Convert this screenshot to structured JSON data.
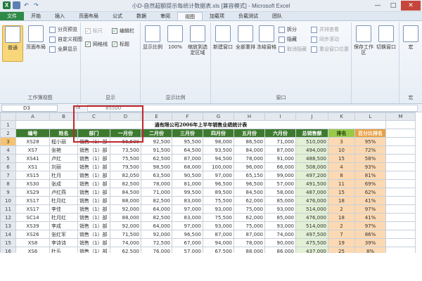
{
  "window": {
    "title": "小D-自然超额提示每统计数据表.xls [兼容模式] - Microsoft Excel",
    "app_icon_letter": "X",
    "controls": [
      "—",
      "□",
      "✕"
    ]
  },
  "tabs": [
    "文件",
    "开始",
    "插入",
    "页面布局",
    "公式",
    "数据",
    "审阅",
    "视图",
    "加载项",
    "负载测试",
    "团队"
  ],
  "active_tab": "视图",
  "ribbon": {
    "group1": {
      "label": "工作簿视图",
      "big_button": "普通",
      "big_button2": "页面布局",
      "items": [
        "分页预览",
        "自定义视图",
        "全屏显示"
      ]
    },
    "group2": {
      "label": "显示",
      "items": [
        "标尺",
        "编辑栏",
        "网格线",
        "标题"
      ]
    },
    "group3": {
      "label": "显示比例",
      "big1": "显示比例",
      "big2": "100%",
      "big3": "缩放到选定区域"
    },
    "group4": {
      "label": "窗口",
      "big1": "新建窗口",
      "big2": "全部重排",
      "big3": "冻结窗格",
      "items": [
        "拆分",
        "隐藏",
        "取消隐藏",
        "并排查看",
        "同步滚动",
        "重设窗口位置"
      ],
      "big4": "保存工作区",
      "big5": "切换窗口"
    },
    "group5": {
      "label": "宏",
      "big1": "宏"
    }
  },
  "formula_bar": {
    "cell_ref": "D3",
    "fx_label": "fx",
    "value": "85500"
  },
  "columns": [
    "A",
    "B",
    "C",
    "D",
    "E",
    "F",
    "G",
    "H",
    "I",
    "J",
    "K",
    "L",
    "M"
  ],
  "sheet_title": "通有限公司2006年上半年销售业绩统计表",
  "headers": [
    "编号",
    "姓名",
    "部门",
    "一月份",
    "二月份",
    "三月份",
    "四月份",
    "五月份",
    "六月份",
    "总销售额",
    "排名",
    "百分比排名"
  ],
  "rows": [
    {
      "n": "3",
      "cells": [
        "XS28",
        "程小丽",
        "销售（1）部",
        "66,500",
        "92,500",
        "95,500",
        "98,000",
        "86,500",
        "71,000",
        "510,000",
        "3",
        "95%"
      ]
    },
    {
      "n": "4",
      "cells": [
        "XS7",
        "张艳",
        "销售（1）部",
        "73,500",
        "91,500",
        "64,500",
        "93,500",
        "84,000",
        "87,000",
        "494,000",
        "10",
        "72%"
      ]
    },
    {
      "n": "5",
      "cells": [
        "XS41",
        "卢红",
        "销售（1）部",
        "75,500",
        "62,500",
        "87,000",
        "94,500",
        "78,000",
        "91,000",
        "488,500",
        "15",
        "58%"
      ]
    },
    {
      "n": "6",
      "cells": [
        "XS1",
        "刘丽",
        "销售（1）部",
        "79,500",
        "98,500",
        "68,000",
        "100,000",
        "96,000",
        "66,000",
        "508,000",
        "4",
        "93%"
      ]
    },
    {
      "n": "7",
      "cells": [
        "XS15",
        "杜月",
        "销售（1）部",
        "82,050",
        "63,500",
        "90,500",
        "97,000",
        "65,150",
        "99,000",
        "497,200",
        "8",
        "81%"
      ]
    },
    {
      "n": "8",
      "cells": [
        "XS30",
        "张成",
        "销售（1）部",
        "82,500",
        "78,000",
        "81,000",
        "96,500",
        "96,500",
        "57,000",
        "491,500",
        "11",
        "69%"
      ]
    },
    {
      "n": "9",
      "cells": [
        "XS29",
        "卢红燕",
        "销售（1）部",
        "84,500",
        "71,000",
        "99,500",
        "89,500",
        "84,500",
        "58,000",
        "487,000",
        "15",
        "62%"
      ]
    },
    {
      "n": "10",
      "cells": [
        "XS17",
        "杜月红",
        "销售（1）部",
        "88,000",
        "82,500",
        "83,000",
        "75,500",
        "62,000",
        "85,000",
        "476,000",
        "18",
        "41%"
      ]
    },
    {
      "n": "11",
      "cells": [
        "XS17",
        "李佳",
        "销售（1）部",
        "92,000",
        "64,000",
        "97,000",
        "93,000",
        "75,000",
        "93,000",
        "514,000",
        "2",
        "97%"
      ]
    },
    {
      "n": "12",
      "cells": [
        "SC14",
        "杜月红",
        "销售（1）部",
        "88,000",
        "82,500",
        "83,000",
        "75,500",
        "62,000",
        "85,000",
        "476,000",
        "18",
        "41%"
      ]
    },
    {
      "n": "13",
      "cells": [
        "XS39",
        "李成",
        "销售（1）部",
        "92,000",
        "64,000",
        "97,000",
        "93,000",
        "75,000",
        "93,000",
        "514,000",
        "2",
        "97%"
      ]
    },
    {
      "n": "14",
      "cells": [
        "XS26",
        "张红军",
        "销售（1）部",
        "71,500",
        "92,000",
        "96,500",
        "87,000",
        "87,000",
        "74,000",
        "497,500",
        "7",
        "86%"
      ]
    },
    {
      "n": "15",
      "cells": [
        "XS8",
        "李诗诗",
        "销售（1）部",
        "74,000",
        "72,500",
        "67,000",
        "94,000",
        "78,000",
        "90,000",
        "475,500",
        "19",
        "39%"
      ]
    },
    {
      "n": "16",
      "cells": [
        "XS6",
        "杜乐",
        "销售（1）部",
        "62,500",
        "76,000",
        "57,000",
        "67,500",
        "88,000",
        "86,000",
        "437,000",
        "25",
        "8%"
      ]
    }
  ]
}
